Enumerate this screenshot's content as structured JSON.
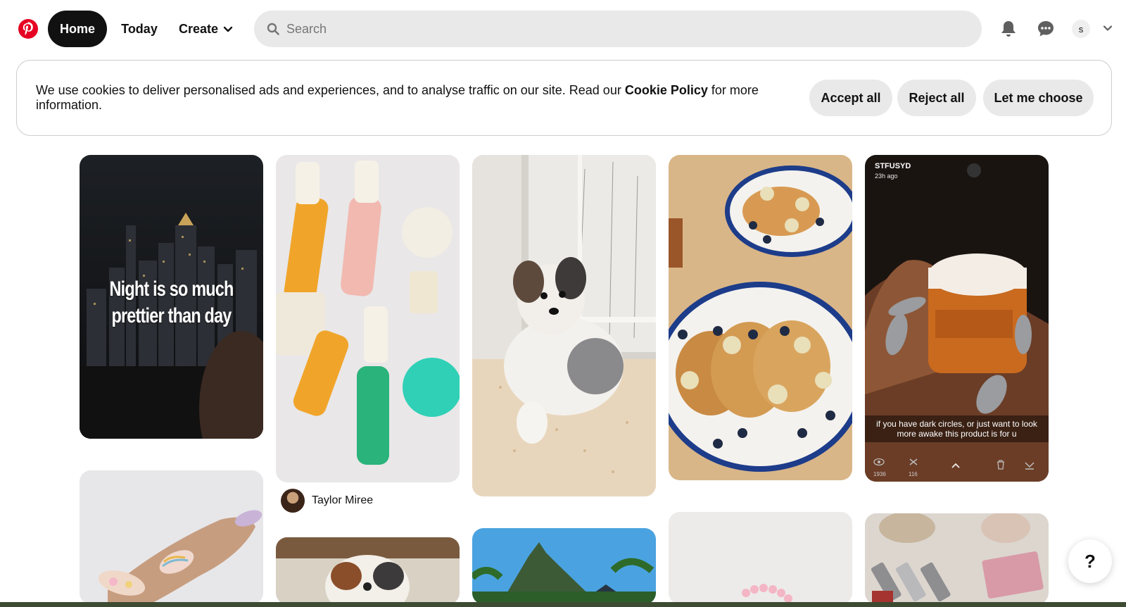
{
  "header": {
    "nav": {
      "home": "Home",
      "today": "Today",
      "create": "Create"
    },
    "search_placeholder": "Search",
    "account_initial": "s"
  },
  "cookie_banner": {
    "text_before": "We use cookies to deliver personalised ads and experiences, and to analyse traffic on our site. Read our ",
    "policy_link": "Cookie Policy",
    "text_after": " for more information.",
    "buttons": {
      "accept": "Accept all",
      "reject": "Reject all",
      "choose": "Let me choose"
    }
  },
  "pins": {
    "night": {
      "caption_line1": "Night is so much",
      "caption_line2": "prettier than day"
    },
    "beauty": {
      "creator": "Taylor Miree"
    },
    "snap": {
      "username": "STFUSYD",
      "time": "23h ago",
      "caption_line1": "if you have dark circles, or just want to look",
      "caption_line2": "more awake this product is for u",
      "views": "1936",
      "screenshots": "116"
    }
  },
  "help_label": "?"
}
